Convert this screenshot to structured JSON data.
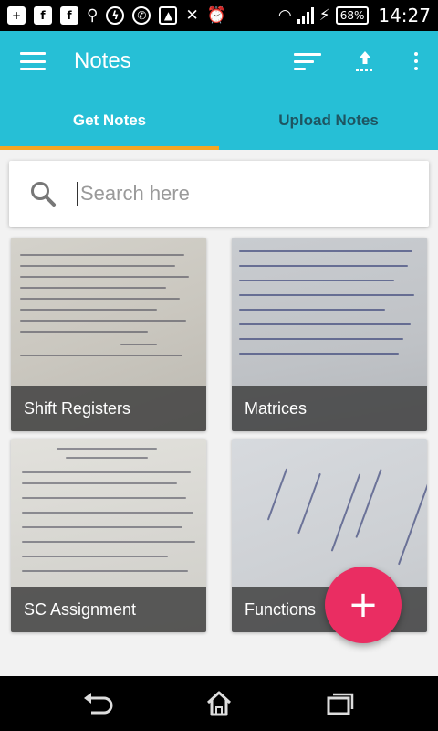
{
  "status_bar": {
    "battery": "68%",
    "time": "14:27"
  },
  "app_bar": {
    "title": "Notes",
    "color": "#26bfd6"
  },
  "tabs": [
    {
      "label": "Get Notes",
      "active": true
    },
    {
      "label": "Upload Notes",
      "active": false
    }
  ],
  "tab_indicator_color": "#f5a623",
  "search": {
    "placeholder": "Search here",
    "value": ""
  },
  "notes": [
    {
      "title": "Shift Registers"
    },
    {
      "title": "Matrices"
    },
    {
      "title": "SC Assignment"
    },
    {
      "title": "Functions"
    }
  ],
  "fab": {
    "label": "+",
    "color": "#ea2d62"
  },
  "icons": {
    "menu": "hamburger-icon",
    "sort": "sort-icon",
    "upload": "upload-icon",
    "more": "more-vert-icon",
    "search": "search-icon",
    "back": "back-icon",
    "home": "home-icon",
    "recents": "recents-icon"
  }
}
